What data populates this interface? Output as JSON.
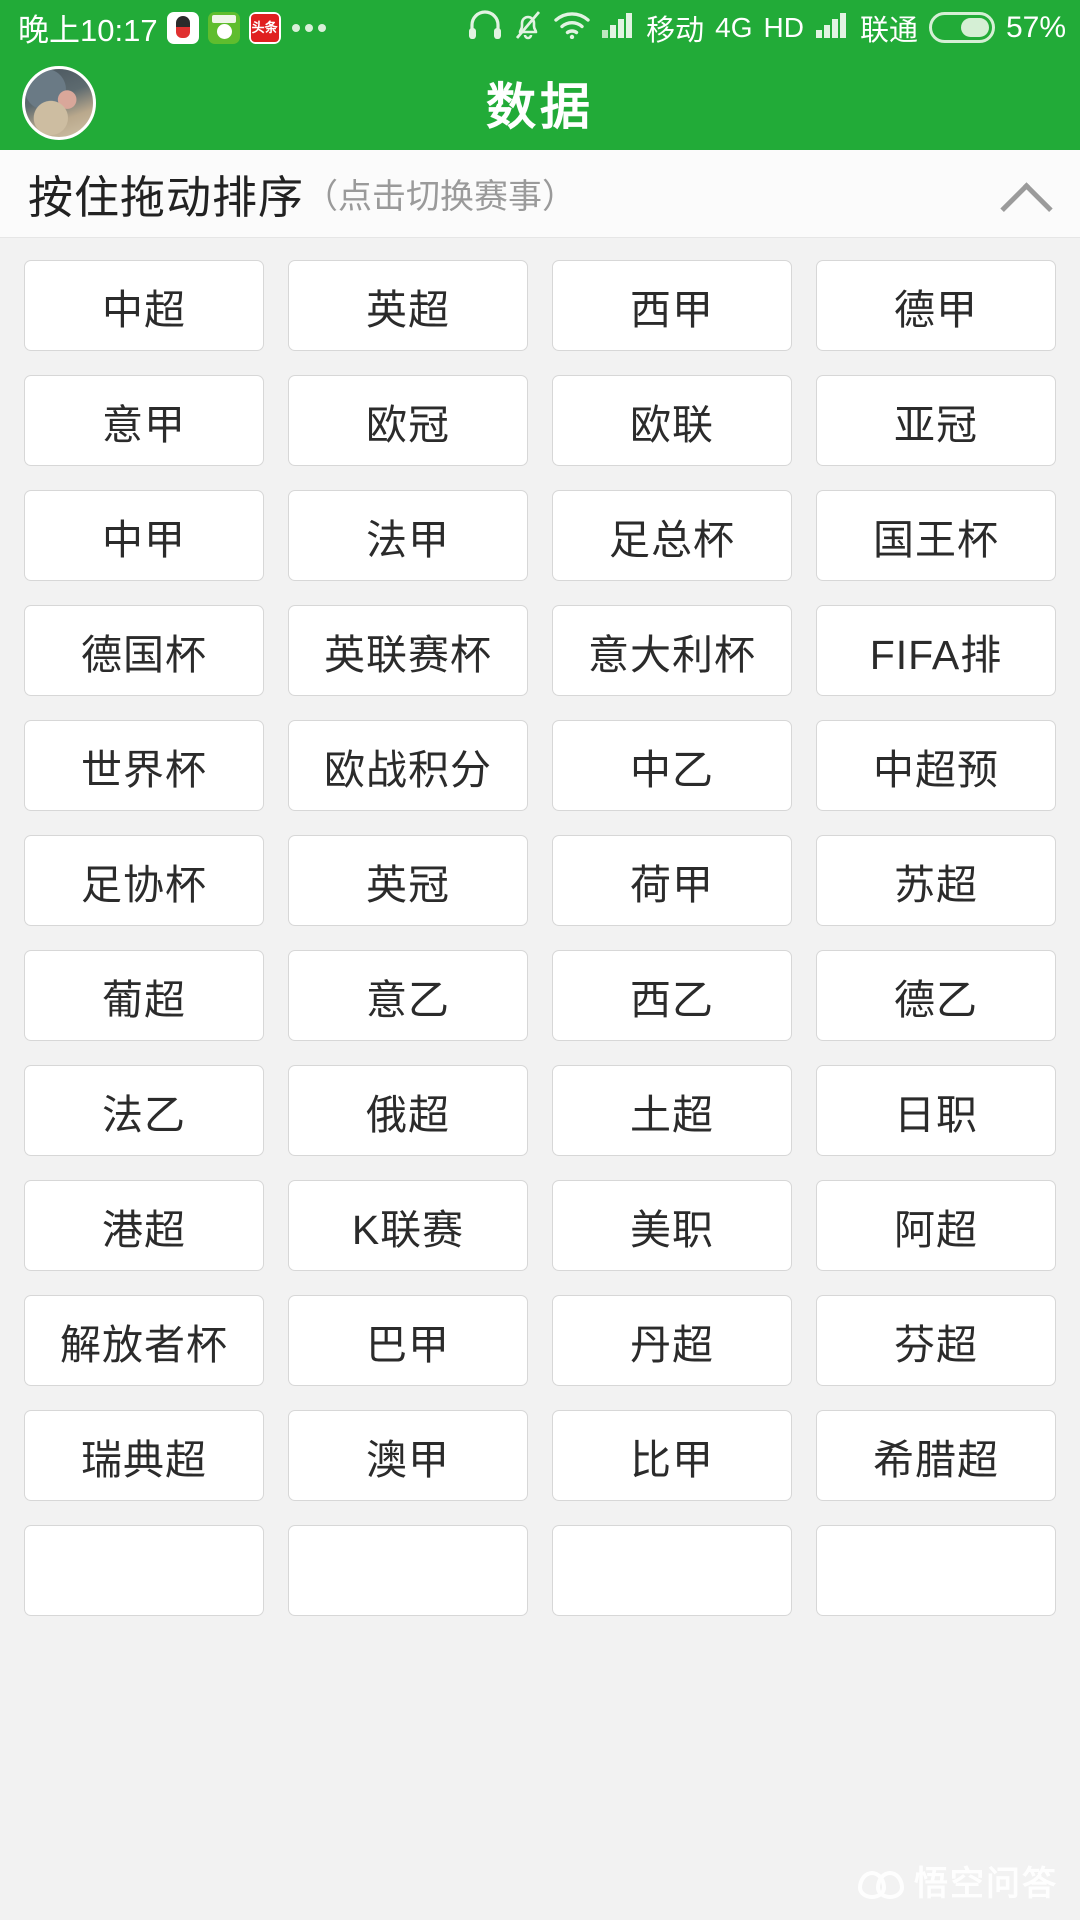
{
  "statusbar": {
    "clock": "晚上10:17",
    "app_icons": [
      "qq-icon",
      "soccer-app-icon",
      "toutiao-icon"
    ],
    "toutiao_label": "头条",
    "overflow": "more-apps-icon",
    "headset_icon": "headset-icon",
    "silent_icon": "bell-muted-icon",
    "wifi_icon": "wifi-icon",
    "signal1_icon": "signal-bars-icon",
    "carrier1": "移动",
    "network": "4G",
    "hd": "HD",
    "signal2_icon": "signal-bars-icon",
    "carrier2": "联通",
    "battery_icon": "battery-icon",
    "battery_percent": "57%"
  },
  "appbar": {
    "avatar": "user-avatar",
    "title": "数据"
  },
  "section": {
    "title": "按住拖动排序",
    "subtitle": "（点击切换赛事）",
    "collapse_icon": "chevron-up-icon"
  },
  "grid": {
    "tiles": [
      "中超",
      "英超",
      "西甲",
      "德甲",
      "意甲",
      "欧冠",
      "欧联",
      "亚冠",
      "中甲",
      "法甲",
      "足总杯",
      "国王杯",
      "德国杯",
      "英联赛杯",
      "意大利杯",
      "FIFA排",
      "世界杯",
      "欧战积分",
      "中乙",
      "中超预",
      "足协杯",
      "英冠",
      "荷甲",
      "苏超",
      "葡超",
      "意乙",
      "西乙",
      "德乙",
      "法乙",
      "俄超",
      "土超",
      "日职",
      "港超",
      "K联赛",
      "美职",
      "阿超",
      "解放者杯",
      "巴甲",
      "丹超",
      "芬超",
      "瑞典超",
      "澳甲",
      "比甲",
      "希腊超",
      "",
      "",
      "",
      ""
    ]
  },
  "watermark": {
    "text": "悟空问答",
    "logo": "wukong-logo"
  },
  "colors": {
    "brand_green": "#22ab38",
    "page_bg": "#f2f2f2",
    "tile_bg": "#ffffff",
    "tile_border": "#d7d7d7",
    "text_primary": "#2b2b2b",
    "text_muted": "#9a9a9a"
  }
}
